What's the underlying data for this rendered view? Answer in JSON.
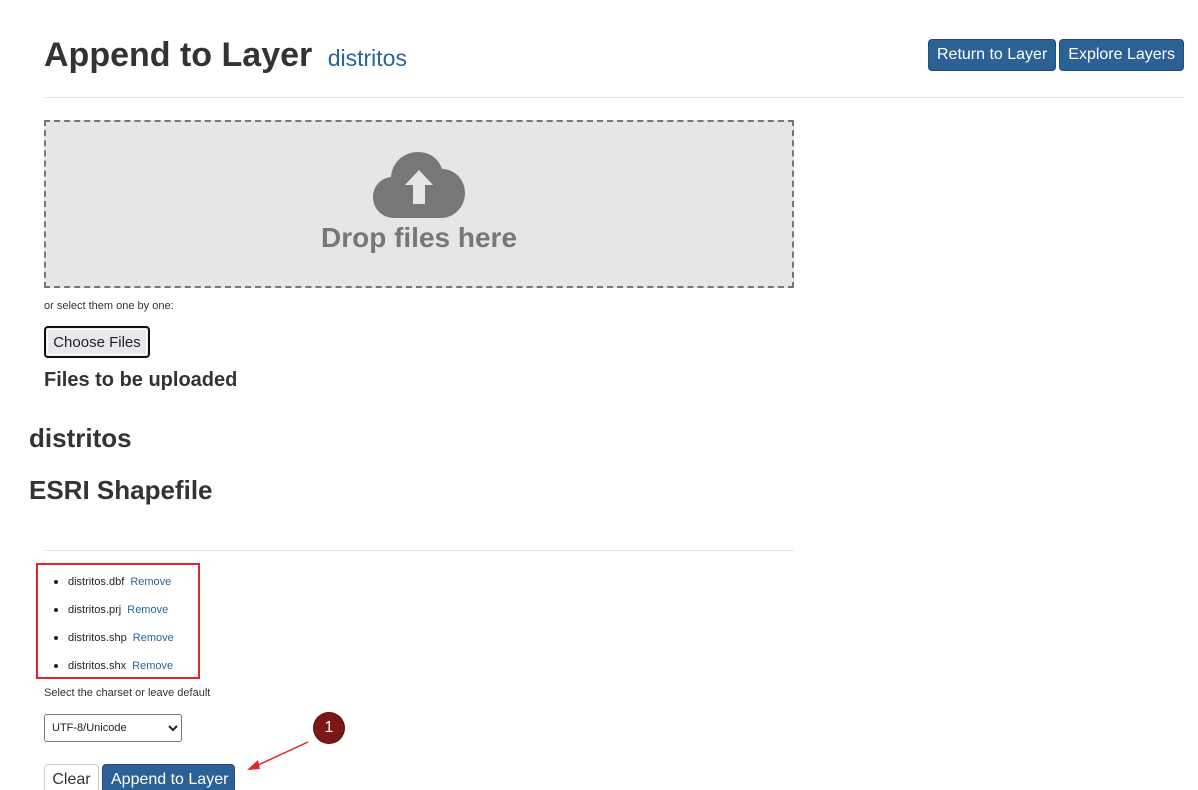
{
  "header": {
    "title": "Append to Layer",
    "layer_name": "distritos",
    "return_button": "Return to Layer",
    "explore_button": "Explore Layers"
  },
  "dropzone": {
    "icon": "cloud-upload-icon",
    "text": "Drop files here"
  },
  "file_select": {
    "hint": "or select them one by one:",
    "choose_button": "Choose Files"
  },
  "upload": {
    "heading": "Files to be uploaded",
    "layer_name": "distritos",
    "file_type": "ESRI Shapefile",
    "files": [
      {
        "name": "distritos.dbf",
        "action": "Remove"
      },
      {
        "name": "distritos.prj",
        "action": "Remove"
      },
      {
        "name": "distritos.shp",
        "action": "Remove"
      },
      {
        "name": "distritos.shx",
        "action": "Remove"
      }
    ]
  },
  "charset": {
    "label": "Select the charset or leave default",
    "selected": "UTF-8/Unicode"
  },
  "actions": {
    "clear": "Clear",
    "append": "Append to Layer"
  },
  "annotation": {
    "callout_number": "1",
    "highlight_color": "#e0262b",
    "callout_color": "#7d1717"
  },
  "colors": {
    "primary": "#2c6195",
    "link": "#2a6496"
  }
}
